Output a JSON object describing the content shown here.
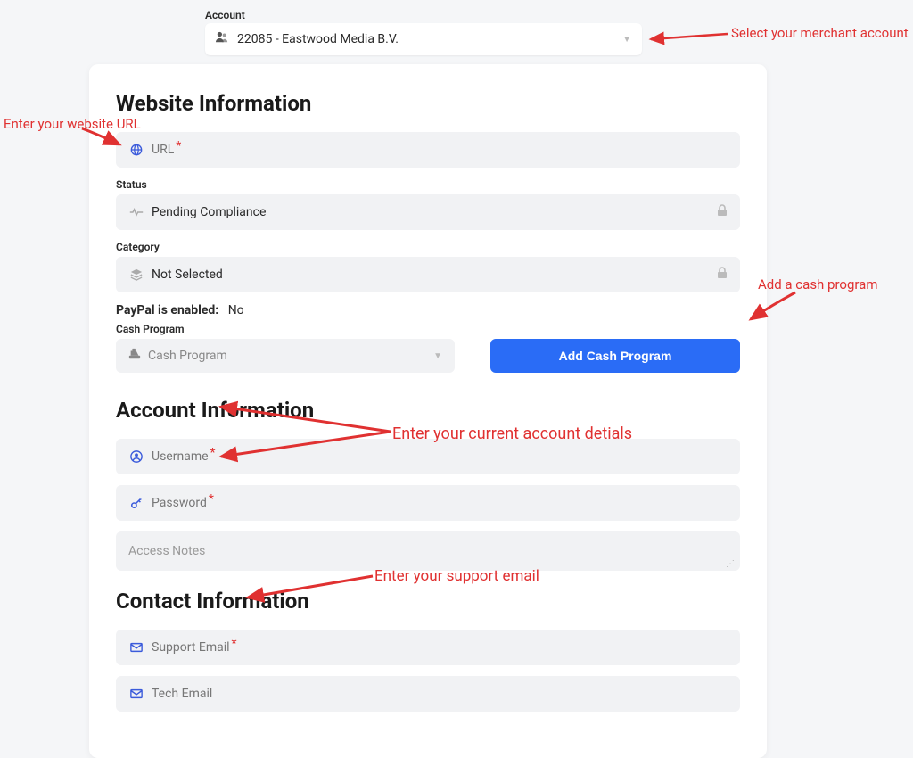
{
  "account": {
    "label": "Account",
    "value": "22085 - Eastwood Media B.V."
  },
  "website": {
    "heading": "Website Information",
    "url_label": "URL",
    "status_label": "Status",
    "status_value": "Pending Compliance",
    "category_label": "Category",
    "category_value": "Not Selected",
    "paypal_label": "PayPal is enabled:",
    "paypal_value": "No",
    "cash_program_label": "Cash Program",
    "cash_program_placeholder": "Cash Program",
    "add_cash_btn": "Add Cash Program"
  },
  "account_info": {
    "heading": "Account Information",
    "username_label": "Username",
    "password_label": "Password",
    "access_notes_placeholder": "Access Notes"
  },
  "contact": {
    "heading": "Contact Information",
    "support_email_label": "Support Email",
    "tech_email_label": "Tech Email"
  },
  "annotations": {
    "select_account": "Select your merchant account",
    "enter_url": "Enter your website URL",
    "add_cash": "Add a cash program",
    "enter_details": "Enter your current account detials",
    "enter_support": "Enter your support email"
  }
}
